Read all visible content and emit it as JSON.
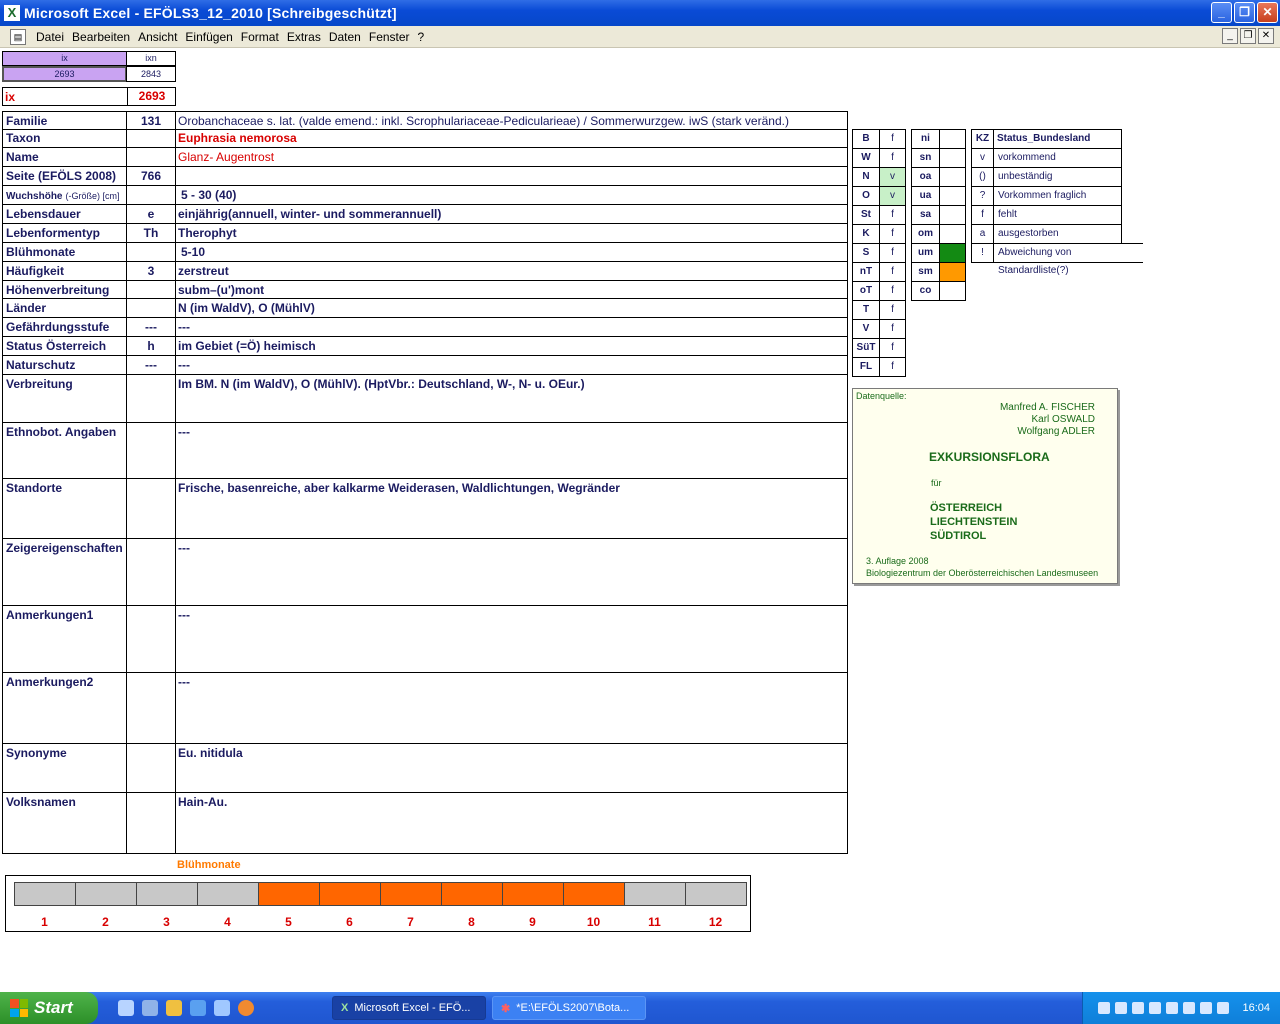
{
  "window": {
    "title": "Microsoft Excel - EFÖLS3_12_2010  [Schreibgeschützt]"
  },
  "menu": [
    "Datei",
    "Bearbeiten",
    "Ansicht",
    "Einfügen",
    "Format",
    "Extras",
    "Daten",
    "Fenster",
    "?"
  ],
  "top_index": {
    "h1": "ix",
    "h2": "ixn",
    "v1": "2693",
    "v2": "2843"
  },
  "ix": {
    "label": "ix",
    "value": "2693"
  },
  "rows": [
    {
      "label": "Familie",
      "code": "131",
      "value": "Orobanchaceae s. lat. (valde emend.: inkl. Scrophulariaceae-Pedicularieae)  /  Sommerwurzgew. iwS (stark veränd.)"
    },
    {
      "label": "Taxon",
      "code": "",
      "value": "Euphrasia nemorosa"
    },
    {
      "label": "Name",
      "code": "",
      "value": "Glanz- Augentrost"
    },
    {
      "label": "Seite (EFÖLS 2008)",
      "code": "766",
      "value": ""
    },
    {
      "label": "Wuchshöhe",
      "label_small": "(-Größe) [cm]",
      "code": "",
      "value": "5 - 30 (40)"
    },
    {
      "label": "Lebensdauer",
      "code": "e",
      "value": "einjährig(annuell, winter- und sommerannuell)"
    },
    {
      "label": "Lebenformentyp",
      "code": "Th",
      "value": "Therophyt"
    },
    {
      "label": "Blühmonate",
      "code": "",
      "value": "5-10"
    },
    {
      "label": "Häufigkeit",
      "code": "3",
      "value": "zerstreut"
    },
    {
      "label": "Höhenverbreitung",
      "code": "",
      "value": "subm–(u')mont"
    },
    {
      "label": "Länder",
      "code": "",
      "value": "N (im WaldV), O (MühlV)"
    },
    {
      "label": "Gefährdungsstufe",
      "code": "---",
      "value": "---"
    },
    {
      "label": "Status Österreich",
      "code": "h",
      "value": "im Gebiet (=Ö) heimisch"
    },
    {
      "label": "Naturschutz",
      "code": "---",
      "value": "---"
    },
    {
      "label": "Verbreitung",
      "code": "",
      "value": "Im BM. N (im WaldV), O (MühlV). (HptVbr.: Deutschland, W-, N- u. OEur.)"
    },
    {
      "label": "Ethnobot. Angaben",
      "code": "",
      "value": "---"
    },
    {
      "label": "Standorte",
      "code": "",
      "value": "Frische, basenreiche, aber kalkarme Weiderasen, Waldlichtungen, Wegränder"
    },
    {
      "label": "Zeigereigenschaften",
      "code": "",
      "value": "---"
    },
    {
      "label": "Anmerkungen1",
      "code": "",
      "value": "---"
    },
    {
      "label": "Anmerkungen2",
      "code": "",
      "value": "---"
    },
    {
      "label": "Synonyme",
      "code": "",
      "value": "Eu. nitidula"
    },
    {
      "label": "Volksnamen",
      "code": "",
      "value": "Hain-Au."
    }
  ],
  "states": [
    {
      "code": "B",
      "value": "f"
    },
    {
      "code": "W",
      "value": "f"
    },
    {
      "code": "N",
      "value": "v"
    },
    {
      "code": "O",
      "value": "v"
    },
    {
      "code": "St",
      "value": "f"
    },
    {
      "code": "K",
      "value": "f"
    },
    {
      "code": "S",
      "value": "f"
    },
    {
      "code": "nT",
      "value": "f"
    },
    {
      "code": "oT",
      "value": "f"
    },
    {
      "code": "T",
      "value": "f"
    },
    {
      "code": "V",
      "value": "f"
    },
    {
      "code": "SüT",
      "value": "f"
    },
    {
      "code": "FL",
      "value": "f"
    }
  ],
  "neighbors": [
    "ni",
    "sn",
    "oa",
    "ua",
    "sa",
    "om",
    "um",
    "sm",
    "co"
  ],
  "status_legend": {
    "header_kz": "KZ",
    "header_title": "Status_Bundesland",
    "items": [
      {
        "kz": "v",
        "text": "vorkommend"
      },
      {
        "kz": "()",
        "text": "unbeständig"
      },
      {
        "kz": "?",
        "text": "Vorkommen fraglich"
      },
      {
        "kz": "f",
        "text": "fehlt"
      },
      {
        "kz": "a",
        "text": "ausgestorben"
      },
      {
        "kz": "!",
        "text": "Abweichung von Standardliste(?)"
      }
    ]
  },
  "source": {
    "label": "Datenquelle:",
    "authors": [
      "Manfred A. FISCHER",
      "Karl OSWALD",
      "Wolfgang ADLER"
    ],
    "title": "EXKURSIONSFLORA",
    "fuer": "für",
    "countries": [
      "ÖSTERREICH",
      "LIECHTENSTEIN",
      "SÜDTIROL"
    ],
    "edition": "3. Auflage 2008",
    "publisher": "Biologiezentrum der Oberösterreichischen Landesmuseen"
  },
  "bloom": {
    "title": "Blühmonate",
    "months": [
      "1",
      "2",
      "3",
      "4",
      "5",
      "6",
      "7",
      "8",
      "9",
      "10",
      "11",
      "12"
    ],
    "active_from": 5,
    "active_to": 10,
    "active_color": "#ff6600",
    "inactive_color": "#c8c8c8"
  },
  "taskbar": {
    "start": "Start",
    "tasks": [
      "Microsoft Excel - EFÖ...",
      "*E:\\EFÖLS2007\\Bota..."
    ],
    "clock": "16:04"
  }
}
